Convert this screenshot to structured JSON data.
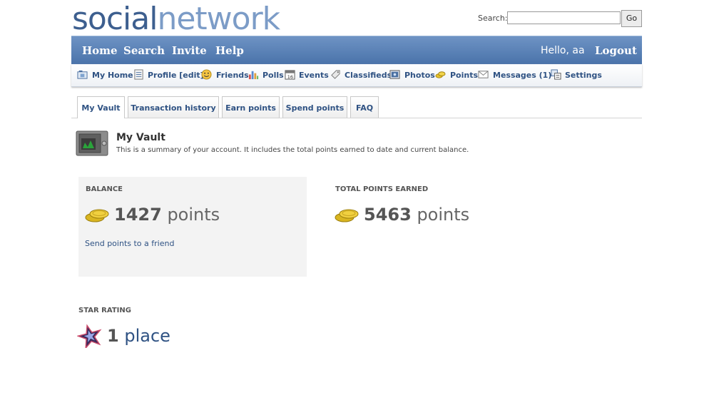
{
  "brand": {
    "part1": "social",
    "part2": "network"
  },
  "search": {
    "label": "Search:",
    "value": "",
    "go": "Go"
  },
  "nav": {
    "home": "Home",
    "search": "Search",
    "invite": "Invite",
    "help": "Help",
    "greeting": "Hello, aa",
    "logout": "Logout"
  },
  "subnav": {
    "my_home": "My Home",
    "profile": "Profile [edit]",
    "friends": "Friends",
    "polls": "Polls",
    "events": "Events",
    "classifieds": "Classifieds",
    "photos": "Photos",
    "points": "Points",
    "messages": "Messages (1)",
    "settings": "Settings"
  },
  "tabs": [
    "My Vault",
    "Transaction history",
    "Earn points",
    "Spend points",
    "FAQ"
  ],
  "vault": {
    "title": "My Vault",
    "description": "This is a summary of your account. It includes the total points earned to date and current balance."
  },
  "balance": {
    "label": "BALANCE",
    "value": "1427",
    "unit": "points",
    "link": "Send points to a friend"
  },
  "total": {
    "label": "TOTAL POINTS EARNED",
    "value": "5463",
    "unit": "points"
  },
  "rating": {
    "label": "STAR RATING",
    "value": "1",
    "unit": "place"
  },
  "colors": {
    "nav_bar": "#4a73aa",
    "link": "#2f5283",
    "logo_dark": "#3d5f8f",
    "logo_light": "#7c9cc7",
    "box_bg": "#f3f3f3"
  }
}
